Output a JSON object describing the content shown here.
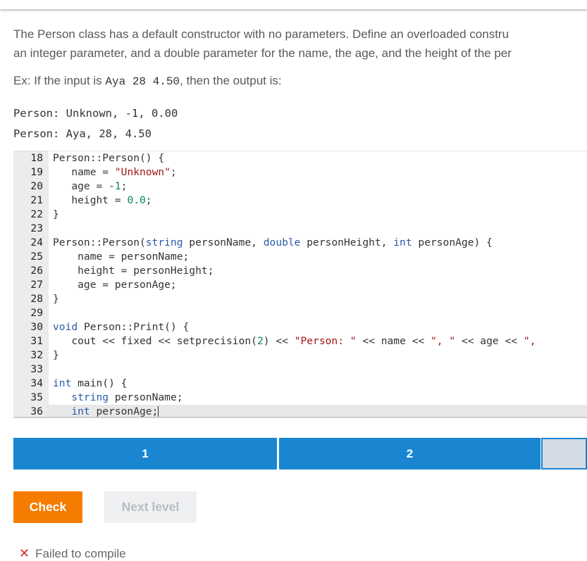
{
  "prompt": {
    "line1": "The Person class has a default constructor with no parameters. Define an overloaded constru",
    "line2": "an integer parameter, and a double parameter for the name, the age, and the height of the per"
  },
  "example": {
    "prefix": "Ex: If the input is ",
    "input": "Aya 28 4.50",
    "suffix": ", then the output is:"
  },
  "expected_output": [
    "Person: Unknown, -1, 0.00",
    "Person: Aya, 28, 4.50"
  ],
  "editor": {
    "lines": [
      {
        "n": "18",
        "code": "Person::Person() {"
      },
      {
        "n": "19",
        "code": "   name = \"Unknown\";"
      },
      {
        "n": "20",
        "code": "   age = -1;"
      },
      {
        "n": "21",
        "code": "   height = 0.0;"
      },
      {
        "n": "22",
        "code": "}"
      },
      {
        "n": "23",
        "code": ""
      },
      {
        "n": "24",
        "code": "Person::Person(string personName, double personHeight, int personAge) {"
      },
      {
        "n": "25",
        "code": "    name = personName;"
      },
      {
        "n": "26",
        "code": "    height = personHeight;"
      },
      {
        "n": "27",
        "code": "    age = personAge;"
      },
      {
        "n": "28",
        "code": "}"
      },
      {
        "n": "29",
        "code": ""
      },
      {
        "n": "30",
        "code": "void Person::Print() {"
      },
      {
        "n": "31",
        "code": "   cout << fixed << setprecision(2) << \"Person: \" << name << \", \" << age << \","
      },
      {
        "n": "32",
        "code": "}"
      },
      {
        "n": "33",
        "code": ""
      },
      {
        "n": "34",
        "code": "int main() {"
      },
      {
        "n": "35",
        "code": "   string personName;"
      },
      {
        "n": "36",
        "code": "   int personAge;"
      }
    ]
  },
  "tabs": [
    {
      "label": "1"
    },
    {
      "label": "2"
    },
    {
      "label": ""
    }
  ],
  "buttons": {
    "check": "Check",
    "next_level": "Next level"
  },
  "status": {
    "icon": "close-icon",
    "text": "Failed to compile"
  },
  "colors": {
    "tab_blue": "#1a86d1",
    "check_orange": "#f57c00",
    "error_red": "#d32f2f"
  }
}
